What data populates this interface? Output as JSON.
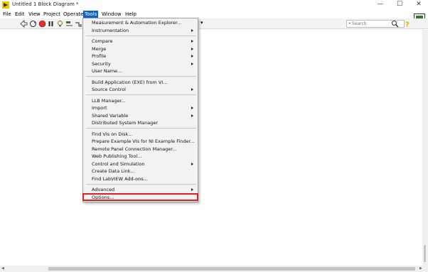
{
  "window": {
    "title": "Untitled 1 Block Diagram *",
    "controls": [
      "—",
      "☐",
      "✕"
    ]
  },
  "menubar": [
    "File",
    "Edit",
    "View",
    "Project",
    "Operate",
    "Tools",
    "Window",
    "Help"
  ],
  "toolbar": {
    "search_placeholder": "Search"
  },
  "tools_menu": {
    "items": [
      {
        "label": "Measurement & Automation Explorer...",
        "submenu": false
      },
      {
        "label": "Instrumentation",
        "submenu": true
      },
      {
        "label": "Compare",
        "submenu": true
      },
      {
        "label": "Merge",
        "submenu": true
      },
      {
        "label": "Profile",
        "submenu": true
      },
      {
        "label": "Security",
        "submenu": true
      },
      {
        "label": "User Name...",
        "submenu": false
      },
      {
        "label": "Build Application (EXE) from VI...",
        "submenu": false
      },
      {
        "label": "Source Control",
        "submenu": true
      },
      {
        "label": "LLB Manager...",
        "submenu": false
      },
      {
        "label": "Import",
        "submenu": true
      },
      {
        "label": "Shared Variable",
        "submenu": true
      },
      {
        "label": "Distributed System Manager",
        "submenu": false
      },
      {
        "label": "Find VIs on Disk...",
        "submenu": false
      },
      {
        "label": "Prepare Example VIs for NI Example Finder...",
        "submenu": false
      },
      {
        "label": "Remote Panel Connection Manager...",
        "submenu": false
      },
      {
        "label": "Web Publishing Tool...",
        "submenu": false
      },
      {
        "label": "Control and Simulation",
        "submenu": true
      },
      {
        "label": "Create Data Link...",
        "submenu": false
      },
      {
        "label": "Find LabVIEW Add-ons...",
        "submenu": false
      },
      {
        "label": "Advanced",
        "submenu": true
      },
      {
        "label": "Options...",
        "submenu": false
      }
    ]
  }
}
